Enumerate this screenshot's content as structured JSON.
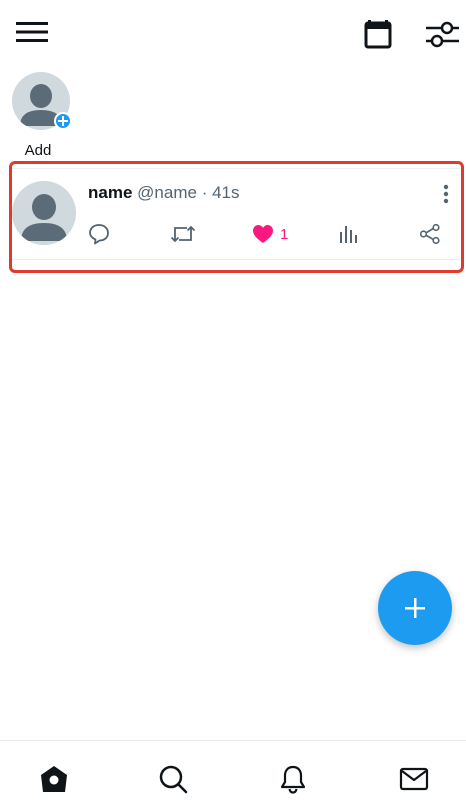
{
  "stories": [
    {
      "label": "Add"
    }
  ],
  "post": {
    "name": "name",
    "handle": "@name",
    "separator": "·",
    "time": "41s",
    "like_count": "1",
    "liked": true
  },
  "colors": {
    "accent": "#1d9bf0",
    "like": "#f91880",
    "highlight_border": "#e0392e",
    "secondary_text": "#536471"
  },
  "icons": {
    "menu": "hamburger-menu-icon",
    "calendar": "calendar-icon",
    "filter": "sliders-icon",
    "reply": "speech-bubble-icon",
    "retweet": "retweet-icon",
    "like": "heart-icon",
    "views": "bar-chart-icon",
    "share": "share-icon",
    "compose": "plus-icon",
    "home": "home-icon",
    "search": "search-icon",
    "notifications": "bell-icon",
    "messages": "envelope-icon"
  }
}
